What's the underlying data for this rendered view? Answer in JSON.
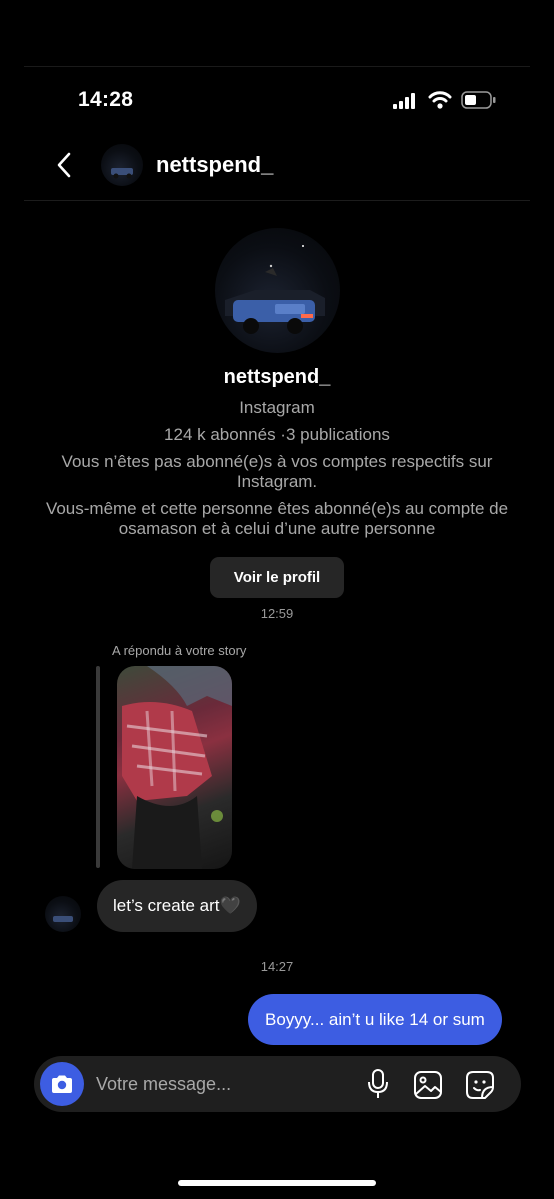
{
  "status_bar": {
    "time": "14:28"
  },
  "header": {
    "username": "nettspend_"
  },
  "profile": {
    "name": "nettspend_",
    "platform": "Instagram",
    "stats": "124 k abonnés ·3 publications",
    "mutual_note": "Vous n’êtes pas abonné(e)s à vos comptes respectifs sur Instagram.",
    "shared_note": "Vous-même et cette personne êtes abonné(e)s au compte de osamason et à celui d’une autre personne",
    "view_profile_label": "Voir le profil"
  },
  "messages": {
    "timestamp_1": "12:59",
    "story_reply_label": "A répondu à votre story",
    "incoming_text": "let’s create art🖤",
    "timestamp_2": "14:27",
    "outgoing_text": "Boyyy... ain’t u like 14 or sum"
  },
  "composer": {
    "placeholder": "Votre message..."
  },
  "icons": {
    "back": "chevron-left-icon",
    "camera": "camera-icon",
    "mic": "microphone-icon",
    "gallery": "image-icon",
    "sticker": "sticker-icon",
    "signal": "signal-icon",
    "wifi": "wifi-icon",
    "battery": "battery-icon"
  },
  "colors": {
    "accent": "#3d5de2",
    "bubble_in": "#262626",
    "background": "#000000"
  }
}
